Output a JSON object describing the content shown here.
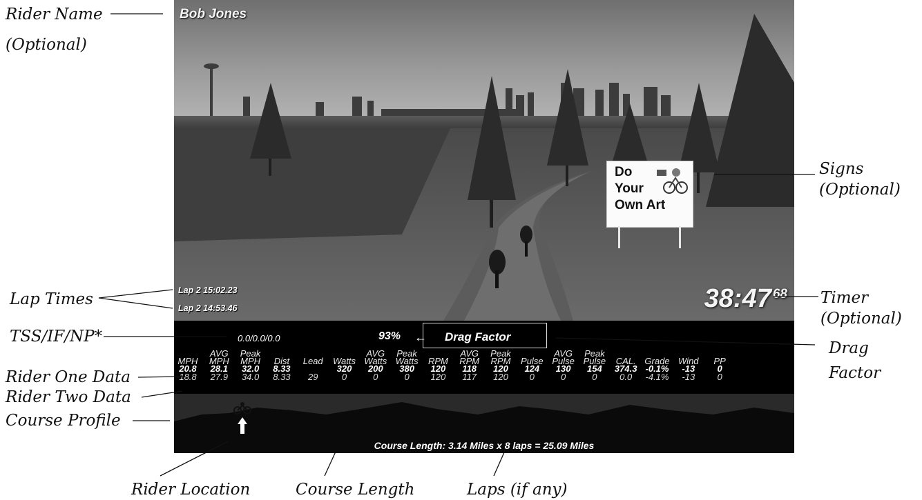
{
  "callouts": {
    "rider_name": [
      "Rider Name",
      "(Optional)"
    ],
    "lap_times": "Lap Times",
    "tss": "TSS/IF/NP*",
    "rider_one": "Rider One Data",
    "rider_two": "Rider Two Data",
    "course_profile": "Course Profile",
    "rider_location": "Rider Location",
    "course_length": "Course Length",
    "laps": "Laps (if any)",
    "signs": [
      "Signs",
      "(Optional)"
    ],
    "timer": [
      "Timer",
      "(Optional)"
    ],
    "drag_factor": [
      "Drag",
      "Factor"
    ]
  },
  "screen": {
    "rider_name": "Bob Jones",
    "laps": [
      "Lap 2 15:02.23",
      "Lap 2 14:53.46"
    ],
    "timer_main": "38:47",
    "timer_hundredths": "68",
    "sign_lines": [
      "Do",
      "Your",
      "Own Art"
    ]
  },
  "panel": {
    "tss_if_np": "0.0/0.0/0.0",
    "drag_percent": "93%",
    "drag_arrow": "←",
    "drag_label": "Drag Factor",
    "columns": [
      {
        "header": [
          "MPH"
        ],
        "r1": "20.8",
        "r2": "18.8"
      },
      {
        "header": [
          "AVG",
          "MPH"
        ],
        "r1": "28.1",
        "r2": "27.9"
      },
      {
        "header": [
          "Peak",
          "MPH"
        ],
        "r1": "32.0",
        "r2": "34.0"
      },
      {
        "header": [
          "Dist"
        ],
        "r1": "8.33",
        "r2": "8.33"
      },
      {
        "header": [
          "Lead"
        ],
        "r1": "",
        "r2": "29"
      },
      {
        "header": [
          "Watts"
        ],
        "r1": "320",
        "r2": "0"
      },
      {
        "header": [
          "AVG",
          "Watts"
        ],
        "r1": "200",
        "r2": "0"
      },
      {
        "header": [
          "Peak",
          "Watts"
        ],
        "r1": "380",
        "r2": "0"
      },
      {
        "header": [
          "RPM"
        ],
        "r1": "120",
        "r2": "120"
      },
      {
        "header": [
          "AVG",
          "RPM"
        ],
        "r1": "118",
        "r2": "117"
      },
      {
        "header": [
          "Peak",
          "RPM"
        ],
        "r1": "120",
        "r2": "120"
      },
      {
        "header": [
          "Pulse"
        ],
        "r1": "124",
        "r2": "0"
      },
      {
        "header": [
          "AVG",
          "Pulse"
        ],
        "r1": "130",
        "r2": "0"
      },
      {
        "header": [
          "Peak",
          "Pulse"
        ],
        "r1": "154",
        "r2": "0"
      },
      {
        "header": [
          "CAL."
        ],
        "r1": "374.3",
        "r2": "0.0"
      },
      {
        "header": [
          "Grade"
        ],
        "r1": "-0.1%",
        "r2": "-4.1%"
      },
      {
        "header": [
          "Wind"
        ],
        "r1": "-13",
        "r2": "-13"
      },
      {
        "header": [
          "PP"
        ],
        "r1": "0",
        "r2": "0"
      }
    ]
  },
  "profile": {
    "course_length_text": "Course Length: 3.14 Miles x 8 laps = 25.09 Miles",
    "rider_position_fraction": 0.11
  }
}
